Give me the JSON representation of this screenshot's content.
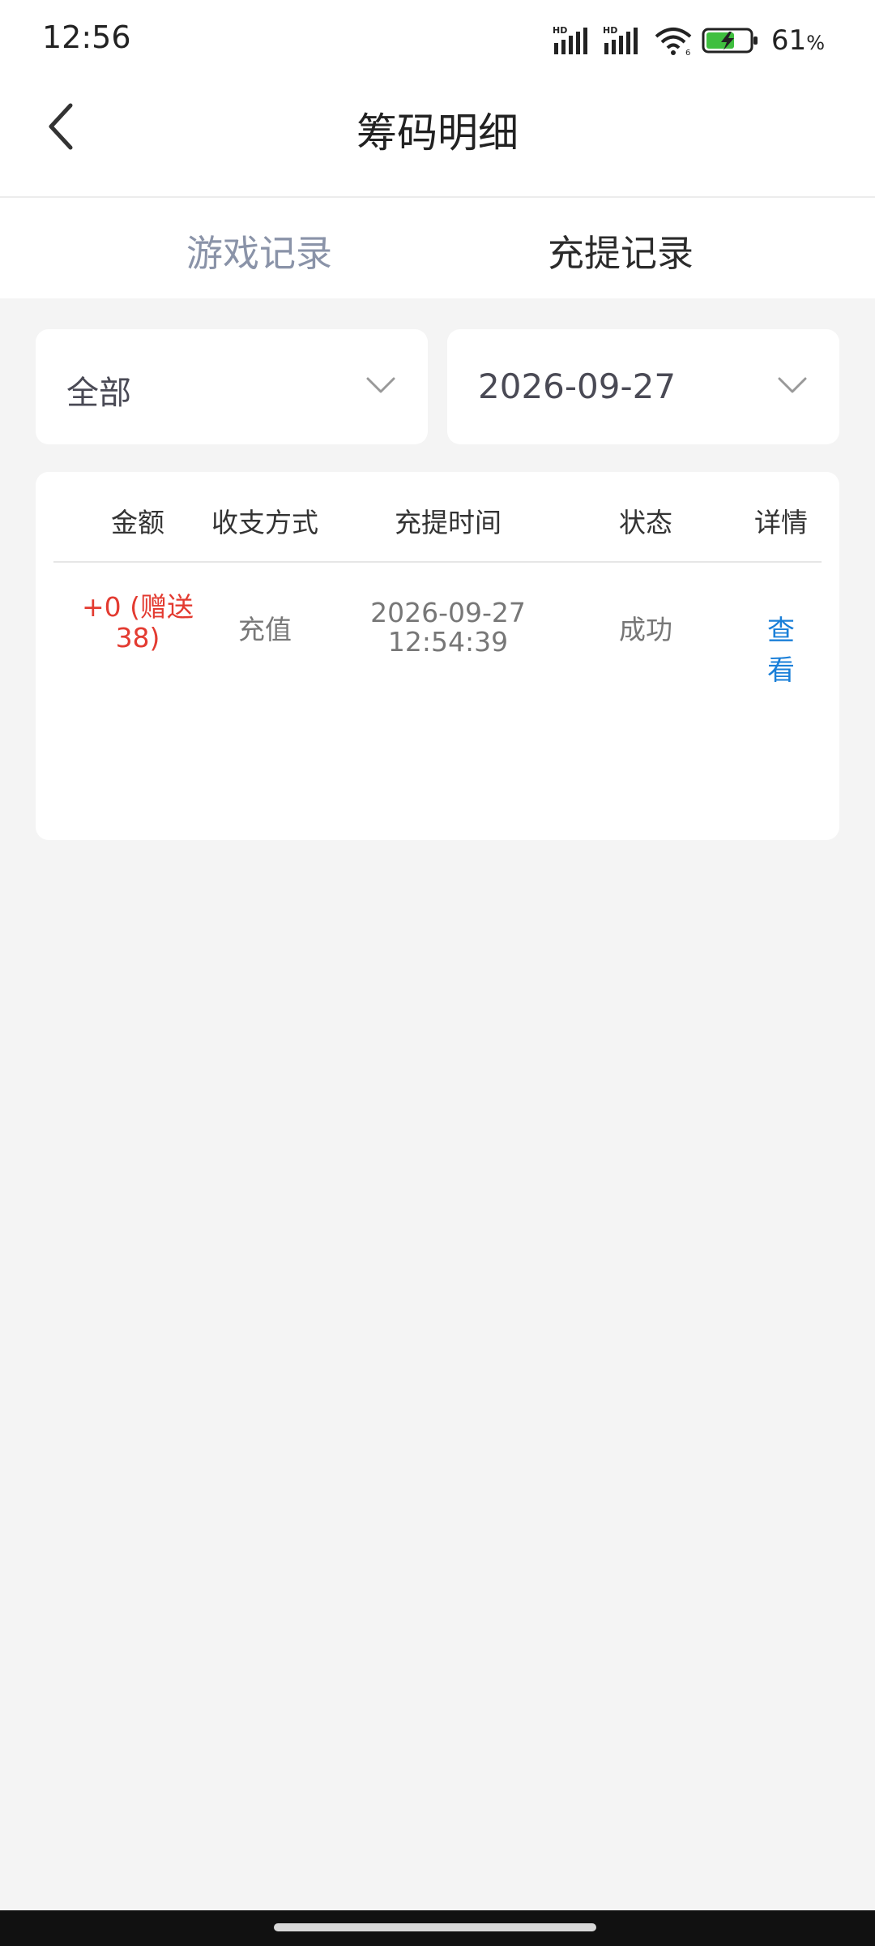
{
  "status_bar": {
    "time": "12:56",
    "battery_percent": "61",
    "percent_sign": "%",
    "icons": [
      "hd-signal-icon",
      "hd-signal-icon",
      "wifi-icon",
      "battery-charging-icon"
    ]
  },
  "header": {
    "title": "筹码明细",
    "back_icon": "chevron-left-icon"
  },
  "tabs": [
    {
      "label": "游戏记录",
      "active": false
    },
    {
      "label": "充提记录",
      "active": true
    }
  ],
  "filters": {
    "type": {
      "value": "全部",
      "icon": "chevron-down-icon"
    },
    "date": {
      "value": "2026-09-27",
      "icon": "chevron-down-icon"
    }
  },
  "table": {
    "columns": [
      "金额",
      "收支方式",
      "充提时间",
      "状态",
      "详情"
    ],
    "rows": [
      {
        "amount": "+0 (赠送38)",
        "method": "充值",
        "date": "2026-09-27",
        "time": "12:54:39",
        "status": "成功",
        "detail": "查看"
      }
    ]
  },
  "colors": {
    "background": "#f4f4f4",
    "amount_red": "#e33b31",
    "link_blue": "#1a7fd8",
    "inactive_tab": "#8a93a8",
    "battery_green": "#3fbf3f"
  }
}
